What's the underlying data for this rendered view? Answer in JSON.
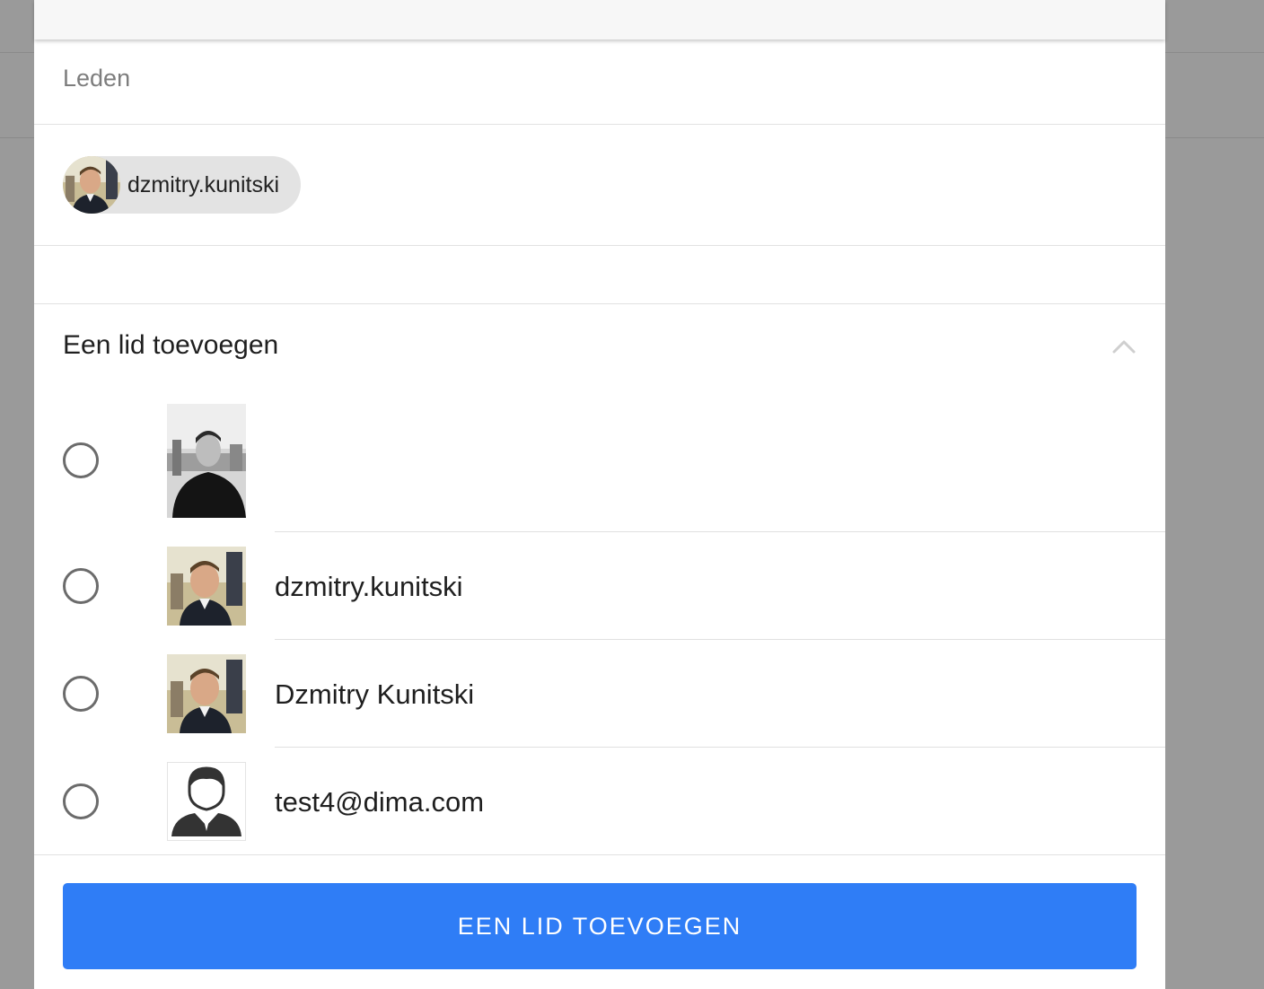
{
  "members_section": {
    "title": "Leden",
    "chips": [
      {
        "label": "dzmitry.kunitski",
        "avatar": "user-photo-color"
      }
    ]
  },
  "add_member_section": {
    "title": "Een lid toevoegen",
    "toggle_icon": "chevron-up-icon",
    "users": [
      {
        "label": "",
        "avatar": "user-photo-grayscale",
        "selected": false
      },
      {
        "label": "dzmitry.kunitski",
        "avatar": "user-photo-color",
        "selected": false
      },
      {
        "label": "Dzmitry Kunitski",
        "avatar": "user-photo-color",
        "selected": false
      },
      {
        "label": "test4@dima.com",
        "avatar": "default-user-icon",
        "selected": false
      }
    ]
  },
  "footer": {
    "button_label": "EEN LID TOEVOEGEN"
  },
  "colors": {
    "primary": "#2f7df6",
    "chip_bg": "#e3e3e3",
    "backdrop": "#9a9a9a"
  }
}
